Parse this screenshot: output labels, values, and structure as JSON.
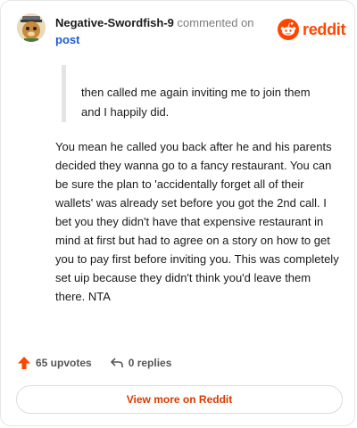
{
  "header": {
    "username": "Negative-Swordfish-9",
    "action": " commented on",
    "post_link": "post",
    "brand": "reddit"
  },
  "comment": {
    "quote": "then called me again inviting me to join them and I happily did.",
    "body": "You mean he called you back after he and his parents decided they wanna go to a fancy restaurant. You can be sure the plan to 'accidentally forget all of their wallets' was already set before you got the 2nd call. I bet you they didn't have that expensive restaurant in mind at first but had to agree on a story on how to get you to pay first before inviting you. This was completely set uip because they didn't think you'd leave them there. NTA"
  },
  "footer": {
    "upvotes": "65 upvotes",
    "replies": "0 replies",
    "view_more": "View more on Reddit"
  },
  "colors": {
    "brand": "#ff4500",
    "link": "#1b5ad1",
    "view_more": "#d93a00"
  },
  "icons": [
    "avatar",
    "reddit-logo-icon",
    "upvote-arrow-icon",
    "reply-arrow-icon"
  ]
}
